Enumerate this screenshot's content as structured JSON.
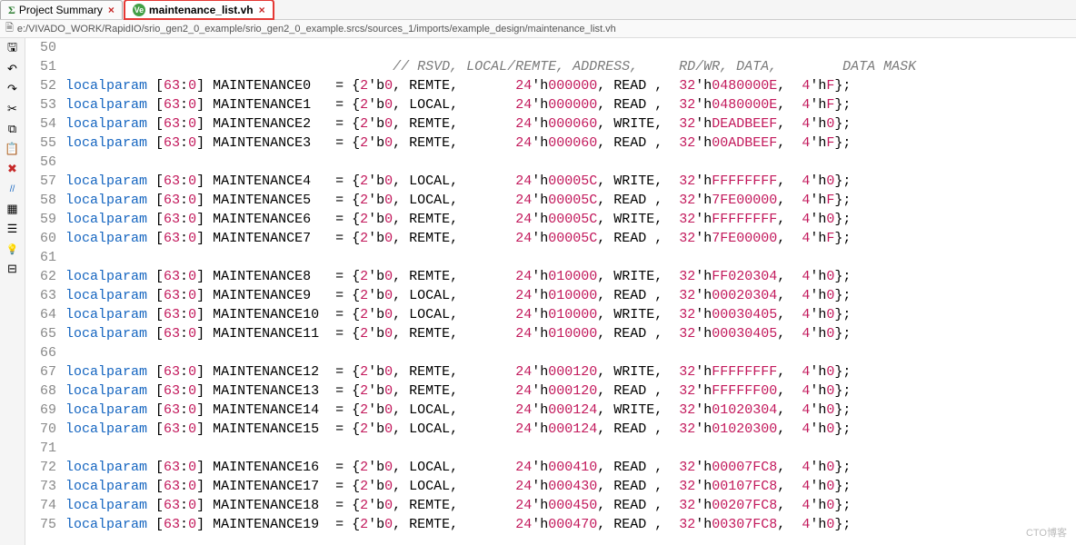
{
  "tabs": [
    {
      "label": "Project Summary",
      "iconType": "sigma",
      "active": false
    },
    {
      "label": "maintenance_list.vh",
      "iconType": "vh",
      "active": true
    }
  ],
  "filePath": "e:/VIVADO_WORK/RapidIO/srio_gen2_0_example/srio_gen2_0_example.srcs/sources_1/imports/example_design/maintenance_list.vh",
  "toolbarIcons": [
    "floppy-icon",
    "undo-icon",
    "redo-icon",
    "cut-icon",
    "copy-icon",
    "paste-icon",
    "delete-icon",
    "comment-icon",
    "select-icon",
    "indent-icon",
    "bulb-icon",
    "collapse-icon"
  ],
  "glyphs": {
    "floppy-icon": "🖫",
    "undo-icon": "↶",
    "redo-icon": "↷",
    "cut-icon": "✂",
    "copy-icon": "⧉",
    "paste-icon": "📋",
    "delete-icon": "✖",
    "comment-icon": "//",
    "select-icon": "▦",
    "indent-icon": "☰",
    "bulb-icon": "💡",
    "collapse-icon": "⊟"
  },
  "commentHeader": "// RSVD, LOCAL/REMTE, ADDRESS,     RD/WR, DATA,        DATA MASK",
  "rows": [
    {
      "ln": 50,
      "blank": true
    },
    {
      "ln": 51,
      "comment": true
    },
    {
      "ln": 52,
      "name": "MAINTENANCE0 ",
      "rsvd": "0",
      "lr": "REMTE",
      "addr": "000000",
      "rw": "READ ",
      "data": "0480000E",
      "mask": "F"
    },
    {
      "ln": 53,
      "name": "MAINTENANCE1 ",
      "rsvd": "0",
      "lr": "LOCAL",
      "addr": "000000",
      "rw": "READ ",
      "data": "0480000E",
      "mask": "F"
    },
    {
      "ln": 54,
      "name": "MAINTENANCE2 ",
      "rsvd": "0",
      "lr": "REMTE",
      "addr": "000060",
      "rw": "WRITE",
      "data": "DEADBEEF",
      "mask": "0"
    },
    {
      "ln": 55,
      "name": "MAINTENANCE3 ",
      "rsvd": "0",
      "lr": "REMTE",
      "addr": "000060",
      "rw": "READ ",
      "data": "00ADBEEF",
      "mask": "F"
    },
    {
      "ln": 56,
      "blank": true
    },
    {
      "ln": 57,
      "name": "MAINTENANCE4 ",
      "rsvd": "0",
      "lr": "LOCAL",
      "addr": "00005C",
      "rw": "WRITE",
      "data": "FFFFFFFF",
      "mask": "0"
    },
    {
      "ln": 58,
      "name": "MAINTENANCE5 ",
      "rsvd": "0",
      "lr": "LOCAL",
      "addr": "00005C",
      "rw": "READ ",
      "data": "7FE00000",
      "mask": "F"
    },
    {
      "ln": 59,
      "name": "MAINTENANCE6 ",
      "rsvd": "0",
      "lr": "REMTE",
      "addr": "00005C",
      "rw": "WRITE",
      "data": "FFFFFFFF",
      "mask": "0"
    },
    {
      "ln": 60,
      "name": "MAINTENANCE7 ",
      "rsvd": "0",
      "lr": "REMTE",
      "addr": "00005C",
      "rw": "READ ",
      "data": "7FE00000",
      "mask": "F"
    },
    {
      "ln": 61,
      "blank": true
    },
    {
      "ln": 62,
      "name": "MAINTENANCE8 ",
      "rsvd": "0",
      "lr": "REMTE",
      "addr": "010000",
      "rw": "WRITE",
      "data": "FF020304",
      "mask": "0"
    },
    {
      "ln": 63,
      "name": "MAINTENANCE9 ",
      "rsvd": "0",
      "lr": "LOCAL",
      "addr": "010000",
      "rw": "READ ",
      "data": "00020304",
      "mask": "0"
    },
    {
      "ln": 64,
      "name": "MAINTENANCE10",
      "rsvd": "0",
      "lr": "LOCAL",
      "addr": "010000",
      "rw": "WRITE",
      "data": "00030405",
      "mask": "0"
    },
    {
      "ln": 65,
      "name": "MAINTENANCE11",
      "rsvd": "0",
      "lr": "REMTE",
      "addr": "010000",
      "rw": "READ ",
      "data": "00030405",
      "mask": "0"
    },
    {
      "ln": 66,
      "blank": true
    },
    {
      "ln": 67,
      "name": "MAINTENANCE12",
      "rsvd": "0",
      "lr": "REMTE",
      "addr": "000120",
      "rw": "WRITE",
      "data": "FFFFFFFF",
      "mask": "0"
    },
    {
      "ln": 68,
      "name": "MAINTENANCE13",
      "rsvd": "0",
      "lr": "REMTE",
      "addr": "000120",
      "rw": "READ ",
      "data": "FFFFFF00",
      "mask": "0"
    },
    {
      "ln": 69,
      "name": "MAINTENANCE14",
      "rsvd": "0",
      "lr": "LOCAL",
      "addr": "000124",
      "rw": "WRITE",
      "data": "01020304",
      "mask": "0"
    },
    {
      "ln": 70,
      "name": "MAINTENANCE15",
      "rsvd": "0",
      "lr": "LOCAL",
      "addr": "000124",
      "rw": "READ ",
      "data": "01020300",
      "mask": "0"
    },
    {
      "ln": 71,
      "blank": true
    },
    {
      "ln": 72,
      "name": "MAINTENANCE16",
      "rsvd": "0",
      "lr": "LOCAL",
      "addr": "000410",
      "rw": "READ ",
      "data": "00007FC8",
      "mask": "0"
    },
    {
      "ln": 73,
      "name": "MAINTENANCE17",
      "rsvd": "0",
      "lr": "LOCAL",
      "addr": "000430",
      "rw": "READ ",
      "data": "00107FC8",
      "mask": "0"
    },
    {
      "ln": 74,
      "name": "MAINTENANCE18",
      "rsvd": "0",
      "lr": "REMTE",
      "addr": "000450",
      "rw": "READ ",
      "data": "00207FC8",
      "mask": "0"
    },
    {
      "ln": 75,
      "name": "MAINTENANCE19",
      "rsvd": "0",
      "lr": "REMTE",
      "addr": "000470",
      "rw": "READ ",
      "data": "00307FC8",
      "mask": "0"
    }
  ],
  "watermark": "CTO博客"
}
